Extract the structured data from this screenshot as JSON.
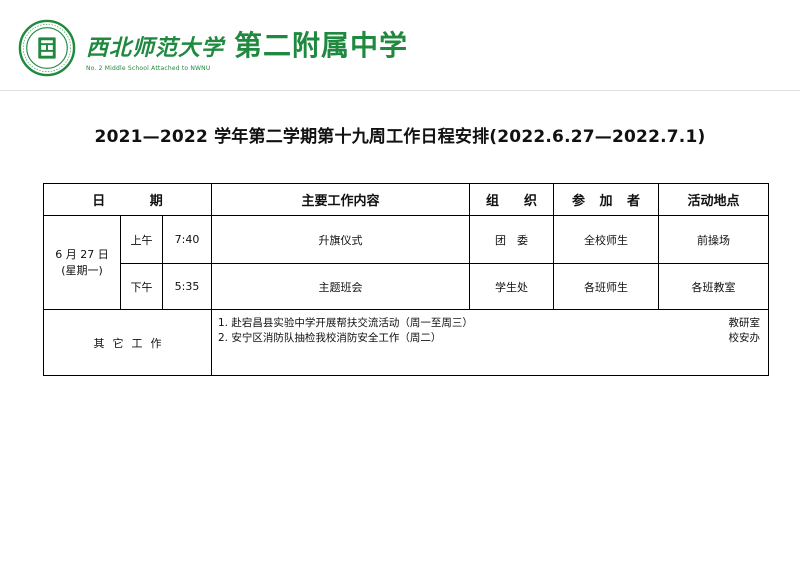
{
  "header": {
    "school_calligraphy": "西北师范大学",
    "school_name": "第二附属中学",
    "school_subtitle": "No. 2 Middle School Attached to NWNU",
    "accent_color": "#1f8a3f",
    "logo_icon": "school-seal-icon"
  },
  "title": "2021—2022 学年第二学期第十九周工作日程安排(2022.6.27—2022.7.1)",
  "table": {
    "headers": {
      "date_a": "日",
      "date_b": "期",
      "content": "主要工作内容",
      "org_a": "组",
      "org_b": "织",
      "part_a": "参",
      "part_b": "加",
      "part_c": "者",
      "location": "活动地点"
    },
    "day": {
      "date": "6 月 27 日",
      "weekday": "(星期一)"
    },
    "rows": [
      {
        "period": "上午",
        "time": "7:40",
        "content": "升旗仪式",
        "org": "团　委",
        "participants": "全校师生",
        "location": "前操场"
      },
      {
        "period": "下午",
        "time": "5:35",
        "content": "主题班会",
        "org": "学生处",
        "participants": "各班师生",
        "location": "各班教室"
      }
    ],
    "other": {
      "label_chars": [
        "其",
        "它",
        "工",
        "作"
      ],
      "tasks": [
        {
          "text": "1. 赴宕昌县实验中学开展帮扶交流活动（周一至周三）",
          "dept": "教研室"
        },
        {
          "text": "2. 安宁区消防队抽检我校消防安全工作（周二）",
          "dept": "校安办"
        }
      ]
    }
  }
}
